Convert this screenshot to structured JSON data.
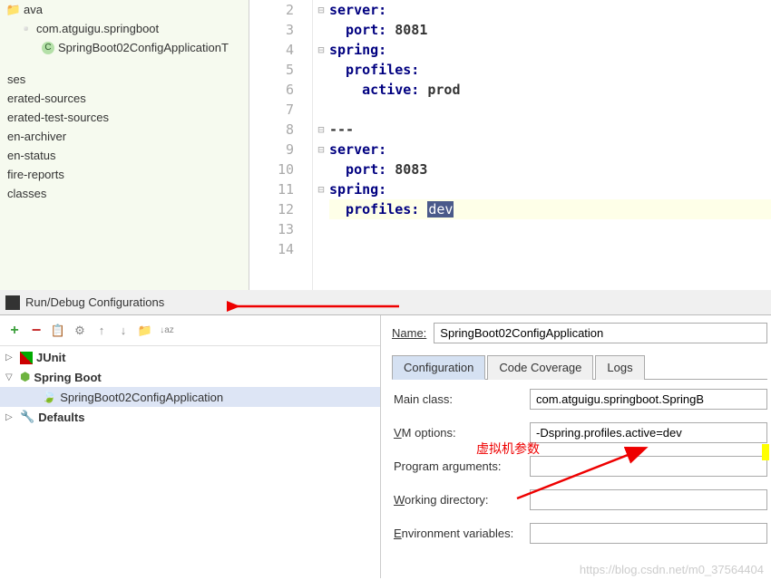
{
  "project_tree": {
    "items": [
      {
        "label": "ava",
        "indent": 0,
        "icon": "folder"
      },
      {
        "label": "com.atguigu.springboot",
        "indent": 1,
        "icon": "package"
      },
      {
        "label": "SpringBoot02ConfigApplicationT",
        "indent": 2,
        "icon": "class"
      },
      {
        "spacer": true
      },
      {
        "label": "ses",
        "indent": 0,
        "icon": "folder"
      },
      {
        "label": "erated-sources",
        "indent": 0,
        "icon": "folder"
      },
      {
        "label": "erated-test-sources",
        "indent": 0,
        "icon": "folder"
      },
      {
        "label": "en-archiver",
        "indent": 0,
        "icon": "folder"
      },
      {
        "label": "en-status",
        "indent": 0,
        "icon": "folder"
      },
      {
        "label": "fire-reports",
        "indent": 0,
        "icon": "folder"
      },
      {
        "label": "classes",
        "indent": 0,
        "icon": "folder"
      }
    ]
  },
  "editor": {
    "lines": [
      {
        "n": 2,
        "tokens": [
          {
            "t": "server:",
            "c": "kw"
          }
        ]
      },
      {
        "n": 3,
        "tokens": [
          {
            "t": "  port: ",
            "c": "kw"
          },
          {
            "t": "8081",
            "c": "val"
          }
        ]
      },
      {
        "n": 4,
        "tokens": [
          {
            "t": "spring:",
            "c": "kw"
          }
        ]
      },
      {
        "n": 5,
        "tokens": [
          {
            "t": "  profiles:",
            "c": "kw"
          }
        ]
      },
      {
        "n": 6,
        "tokens": [
          {
            "t": "    active: ",
            "c": "kw"
          },
          {
            "t": "prod",
            "c": "val"
          }
        ]
      },
      {
        "n": 7,
        "tokens": []
      },
      {
        "n": 8,
        "tokens": [
          {
            "t": "---",
            "c": "val"
          }
        ]
      },
      {
        "n": 9,
        "tokens": [
          {
            "t": "server:",
            "c": "kw"
          }
        ]
      },
      {
        "n": 10,
        "tokens": [
          {
            "t": "  port: ",
            "c": "kw"
          },
          {
            "t": "8083",
            "c": "val"
          }
        ]
      },
      {
        "n": 11,
        "tokens": [
          {
            "t": "spring:",
            "c": "kw"
          }
        ]
      },
      {
        "n": 12,
        "tokens": [
          {
            "t": "  profiles: ",
            "c": "kw"
          },
          {
            "t": "dev",
            "c": "sel"
          }
        ],
        "hl": true
      },
      {
        "n": 13,
        "tokens": []
      },
      {
        "n": 14,
        "tokens": []
      }
    ]
  },
  "dialog": {
    "title": "Run/Debug Configurations",
    "tree": [
      {
        "label": "JUnit",
        "icon": "junit",
        "expanded": false,
        "bold": true
      },
      {
        "label": "Spring Boot",
        "icon": "spring",
        "expanded": true,
        "bold": true
      },
      {
        "label": "SpringBoot02ConfigApplication",
        "icon": "spring-leaf",
        "child": true,
        "selected": true
      },
      {
        "label": "Defaults",
        "icon": "wrench",
        "expanded": false,
        "bold": true
      }
    ],
    "name_label": "Name:",
    "name_value": "SpringBoot02ConfigApplication",
    "tabs": [
      {
        "label": "Configuration",
        "active": true
      },
      {
        "label": "Code Coverage",
        "active": false
      },
      {
        "label": "Logs",
        "active": false
      }
    ],
    "fields": {
      "main_class": {
        "label": "Main class:",
        "value": "com.atguigu.springboot.SpringB"
      },
      "vm_options": {
        "label": "VM options:",
        "value": "-Dspring.profiles.active=dev"
      },
      "program_args": {
        "label": "Program arguments:",
        "value": ""
      },
      "working_dir": {
        "label": "Working directory:",
        "value": ""
      },
      "env_vars": {
        "label": "Environment variables:",
        "value": ""
      }
    }
  },
  "annotation": {
    "text": "虚拟机参数"
  },
  "watermark": "https://blog.csdn.net/m0_37564404"
}
